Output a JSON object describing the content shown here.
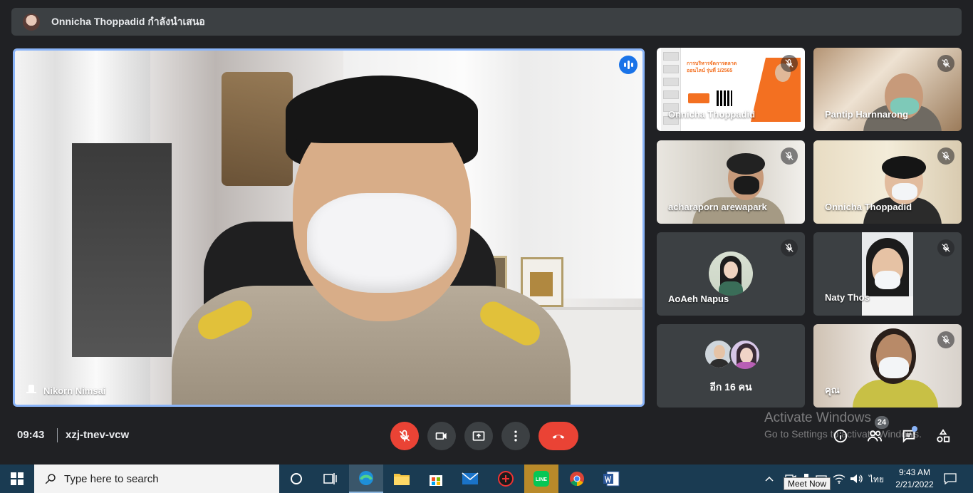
{
  "banner": {
    "text": "Onnicha Thoppadid กำลังนำเสนอ"
  },
  "main_tile": {
    "name": "Nikorn Nimsai"
  },
  "tiles": [
    {
      "name": "Onnicha Thoppadid",
      "muted": true
    },
    {
      "name": "Pantip Harnnarong",
      "muted": true
    },
    {
      "name": "acharaporn arewapark",
      "muted": true
    },
    {
      "name": "Onnicha Thoppadid",
      "muted": true
    },
    {
      "name": "AoAeh Napus",
      "muted": true
    },
    {
      "name": "Naty Thos",
      "muted": true
    },
    {
      "name": "อีก 16 คน",
      "muted": false
    },
    {
      "name": "คุณ",
      "muted": true
    }
  ],
  "slide": {
    "title": "การบริหารจัดการตลาด ออนไลน์ รุ่นที่ 1/2565"
  },
  "meeting": {
    "time": "09:43",
    "code": "xzj-tnev-vcw"
  },
  "controls": [
    "mic-off",
    "camera",
    "present",
    "more",
    "leave-call"
  ],
  "right_controls": {
    "participants_count": "24"
  },
  "watermark": {
    "title": "Activate Windows",
    "subtitle": "Go to Settings to activate Windows."
  },
  "taskbar": {
    "search_placeholder": "Type here to search",
    "apps": [
      "Task View",
      "Microsoft Edge",
      "File Explorer",
      "Microsoft Store",
      "Mail",
      "App",
      "LINE",
      "Google Chrome",
      "Microsoft Word"
    ],
    "line_label": "LINE",
    "lang": "ไทย",
    "clock_time": "9:43 AM",
    "clock_date": "2/21/2022",
    "tooltip": "Meet Now"
  },
  "colors": {
    "accent_blue": "#8ab4f8",
    "end_call_red": "#ea4335",
    "bg": "#202124",
    "tile_bg": "#3c4043"
  }
}
